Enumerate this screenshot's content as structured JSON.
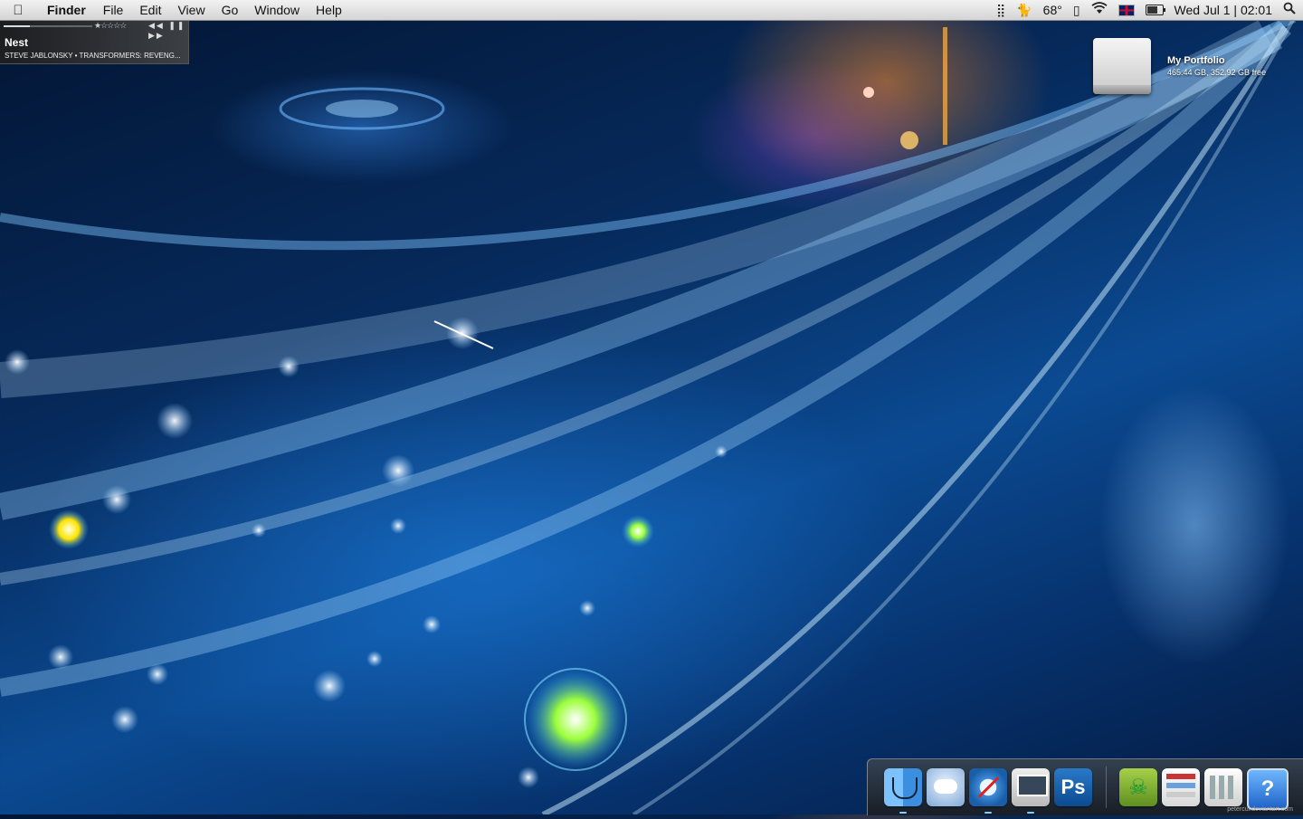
{
  "menubar": {
    "apple_icon": "apple-icon",
    "app_name": "Finder",
    "items": [
      "File",
      "Edit",
      "View",
      "Go",
      "Window",
      "Help"
    ],
    "status": {
      "temperature": "68°",
      "date_time": "Wed Jul 1 | 02:01",
      "icons": [
        "menu-extras-icon",
        "cat-icon",
        "usb-icon",
        "wifi-icon",
        "uk-flag-icon",
        "battery-icon",
        "spotlight-icon"
      ]
    }
  },
  "now_playing": {
    "title": "Nest",
    "artist_album": "STEVE JABLONSKY • TRANSFORMERS: REVENG...",
    "rating_stars": "★☆☆☆☆",
    "controls": "◀◀ ❚❚ ▶▶",
    "progress": 0.3
  },
  "desktop": {
    "drive": {
      "name": "My Portfolio",
      "info": "465.44 GB, 352.92 GB free"
    }
  },
  "dock": {
    "items": [
      {
        "name": "Finder",
        "icon": "finder-icon",
        "running": true
      },
      {
        "name": "iChat",
        "icon": "ichat-icon",
        "running": false
      },
      {
        "name": "Safari",
        "icon": "safari-icon",
        "running": true
      },
      {
        "name": "Screen Sharing",
        "icon": "monitor-icon",
        "running": true
      },
      {
        "name": "Photoshop",
        "icon": "photoshop-icon",
        "label": "Ps",
        "running": false
      },
      {
        "name": "Transmission",
        "icon": "pirate-icon",
        "label": "☠",
        "running": false
      },
      {
        "name": "Document",
        "icon": "webpage-doc-icon",
        "running": false
      },
      {
        "name": "Document 2",
        "icon": "columns-doc-icon",
        "running": false
      },
      {
        "name": "Help",
        "icon": "help-icon",
        "label": "?",
        "running": false
      }
    ],
    "credit": "petercui.deviantart.com"
  }
}
